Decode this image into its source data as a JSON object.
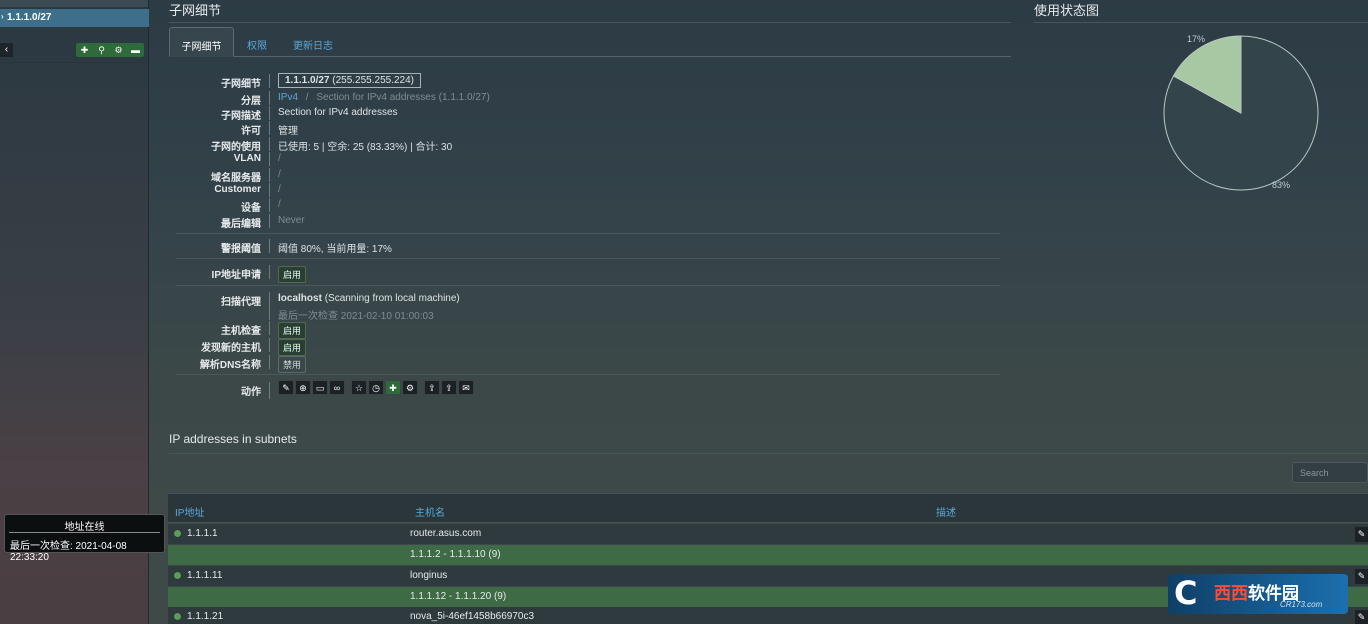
{
  "sidebar": {
    "active_subnet": "1.1.1.0/27",
    "back_icon": "chevron-left-icon",
    "toolbar_icons": [
      "plus-icon",
      "search-icon",
      "gears-icon",
      "folder-icon"
    ],
    "tooltip": {
      "title": "地址在线",
      "last_check": "最后一次检查: 2021-04-08 22:33:20"
    }
  },
  "header": {
    "title": "子网细节",
    "right_title": "使用状态图"
  },
  "tabs": [
    {
      "label": "子网细节",
      "active": true
    },
    {
      "label": "权限",
      "active": false
    },
    {
      "label": "更新日志",
      "active": false
    }
  ],
  "details": {
    "subnet": {
      "label": "子网细节",
      "value": "1.1.1.0/27",
      "mask": "(255.255.255.224)"
    },
    "hierarchy": {
      "label": "分层",
      "link": "IPv4",
      "sep": "/",
      "rest": "Section for IPv4 addresses (1.1.1.0/27)"
    },
    "description": {
      "label": "子网描述",
      "value": "Section for IPv4 addresses"
    },
    "permission": {
      "label": "许可",
      "value": "管理"
    },
    "usage": {
      "label": "子网的使用",
      "value": "已使用: 5 | 空余: 25 (83.33%) | 合计: 30"
    },
    "vlan": {
      "label": "VLAN",
      "value": "/"
    },
    "nameservers": {
      "label": "域名服务器",
      "value": "/"
    },
    "customer": {
      "label": "Customer",
      "value": "/"
    },
    "device": {
      "label": "设备",
      "value": "/"
    },
    "last_edited": {
      "label": "最后编辑",
      "value": "Never"
    },
    "threshold": {
      "label": "警报阈值",
      "value": "阈值 80%, 当前用量: 17%"
    },
    "ip_request": {
      "label": "IP地址申请",
      "value": "启用"
    },
    "scan_agent": {
      "label": "扫描代理",
      "name": "localhost",
      "desc": "(Scanning from local machine)",
      "last_check": "最后一次检查 2021-02-10 01:00:03"
    },
    "host_check": {
      "label": "主机检查",
      "value": "启用"
    },
    "discover_hosts": {
      "label": "发现新的主机",
      "value": "启用"
    },
    "resolve_dns": {
      "label": "解析DNS名称",
      "value": "禁用"
    },
    "actions": {
      "label": "动作",
      "icons": [
        "pencil-icon",
        "plus-circle-icon",
        "card-icon",
        "link-icon",
        "star-icon",
        "clock-icon",
        "plus-icon",
        "gears-icon",
        "upload-icon",
        "upload-icon",
        "envelope-icon"
      ]
    }
  },
  "chart_data": {
    "type": "pie",
    "title": "使用状态图",
    "categories": [
      "used",
      "free"
    ],
    "values": [
      17,
      83
    ],
    "labels": [
      "17%",
      "83%"
    ],
    "colors": [
      "#a7c8a2",
      "#33444b"
    ]
  },
  "ip_section": {
    "title": "IP addresses in subnets",
    "search_placeholder": "Search",
    "columns": [
      "IP地址",
      "主机名",
      "描述"
    ],
    "rows": [
      {
        "type": "ip",
        "ip": "1.1.1.1",
        "hostname": "router.asus.com"
      },
      {
        "type": "free",
        "range": "1.1.1.2 - 1.1.1.10 (9)"
      },
      {
        "type": "ip",
        "ip": "1.1.1.11",
        "hostname": "longinus"
      },
      {
        "type": "free",
        "range": "1.1.1.12 - 1.1.1.20 (9)"
      },
      {
        "type": "ip",
        "ip": "1.1.1.21",
        "hostname": "nova_5i-46ef1458b66970c3"
      }
    ]
  },
  "watermark": {
    "prefix": "西西",
    "suffix": "软件园",
    "url": "CR173.com"
  }
}
